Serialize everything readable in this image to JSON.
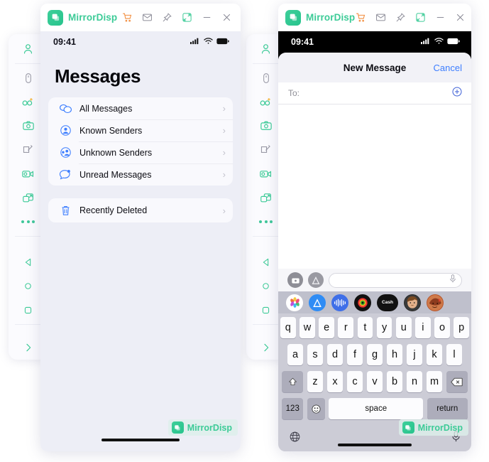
{
  "app": {
    "name": "MirrorDisp",
    "logo_icon": "mirror-logo-icon",
    "titlebar_icons": [
      {
        "name": "cart-icon",
        "color": "#f28c3c"
      },
      {
        "name": "mail-icon",
        "color": "#8d8d99"
      },
      {
        "name": "pin-icon",
        "color": "#8d8d99"
      },
      {
        "name": "fullscreen-icon",
        "color": "#3ccb97"
      },
      {
        "name": "minimize-icon",
        "color": "#8d8d99"
      },
      {
        "name": "close-icon",
        "color": "#8d8d99"
      }
    ]
  },
  "sidebar": {
    "items": [
      {
        "name": "account-icon",
        "color": "#3ccb97"
      },
      {
        "name": "mouse-icon",
        "color": "#9a9aa6"
      },
      {
        "name": "link-add-icon",
        "color": "#3ccb97"
      },
      {
        "name": "camera-icon",
        "color": "#3ccb97"
      },
      {
        "name": "whiteboard-icon",
        "color": "#9a9aa6"
      },
      {
        "name": "video-record-icon",
        "color": "#3ccb97"
      },
      {
        "name": "screen-share-icon",
        "color": "#3ccb97"
      },
      {
        "name": "more-icon",
        "color": "#3ccb97"
      },
      {
        "name": "back-icon",
        "color": "#3ccb97"
      },
      {
        "name": "home-icon",
        "color": "#3ccb97"
      },
      {
        "name": "recents-icon",
        "color": "#3ccb97"
      },
      {
        "name": "expand-icon",
        "color": "#3ccb97"
      }
    ]
  },
  "left_window": {
    "status": {
      "time": "09:41",
      "signal_icon": "cellular-signal-icon",
      "wifi_icon": "wifi-icon",
      "battery_icon": "battery-full-icon"
    },
    "page_title": "Messages",
    "filter_list": [
      {
        "label": "All Messages",
        "icon": "chat-bubbles-icon",
        "chevron": "›"
      },
      {
        "label": "Known Senders",
        "icon": "person-circle-icon",
        "chevron": "›"
      },
      {
        "label": "Unknown Senders",
        "icon": "people-circle-icon",
        "chevron": "›"
      },
      {
        "label": "Unread Messages",
        "icon": "unread-bubble-icon",
        "chevron": "›"
      }
    ],
    "secondary_list": [
      {
        "label": "Recently Deleted",
        "icon": "trash-icon",
        "chevron": "›"
      }
    ]
  },
  "right_window": {
    "status": {
      "time": "09:41",
      "signal_icon": "cellular-signal-icon",
      "wifi_icon": "wifi-icon",
      "battery_icon": "battery-full-icon"
    },
    "navbar": {
      "title": "New Message",
      "cancel_label": "Cancel"
    },
    "to_field": {
      "label": "To:",
      "value": "",
      "add_contact_icon": "add-contact-plus-icon"
    },
    "input_bar": {
      "camera_icon": "camera-icon",
      "appstore_icon": "app-store-icon",
      "placeholder": "",
      "mic_icon": "microphone-icon"
    },
    "app_strip": [
      {
        "name": "photos-app-icon",
        "color": "#ffffff"
      },
      {
        "name": "app-store-app-icon",
        "color": "#2f8cf5"
      },
      {
        "name": "audio-message-app-icon",
        "color": "#3f6fe8"
      },
      {
        "name": "music-app-icon",
        "color": "#111111"
      },
      {
        "name": "apple-cash-app-icon",
        "color": "#111111",
        "label": "Cash"
      },
      {
        "name": "memoji-app-icon",
        "color": "#2b2b2b"
      },
      {
        "name": "stickers-app-icon",
        "color": "#b8562c"
      }
    ],
    "keyboard": {
      "row1": [
        "q",
        "w",
        "e",
        "r",
        "t",
        "y",
        "u",
        "i",
        "o",
        "p"
      ],
      "row2": [
        "a",
        "s",
        "d",
        "f",
        "g",
        "h",
        "j",
        "k",
        "l"
      ],
      "row3": [
        "z",
        "x",
        "c",
        "v",
        "b",
        "n",
        "m"
      ],
      "shift_icon": "shift-icon",
      "backspace_icon": "backspace-icon",
      "numbers_label": "123",
      "emoji_icon": "emoji-icon",
      "space_label": "space",
      "return_label": "return",
      "globe_icon": "globe-icon",
      "dictation_icon": "microphone-icon"
    }
  },
  "watermark": {
    "text": "MirrorDisp",
    "logo_icon": "mirror-logo-icon"
  }
}
